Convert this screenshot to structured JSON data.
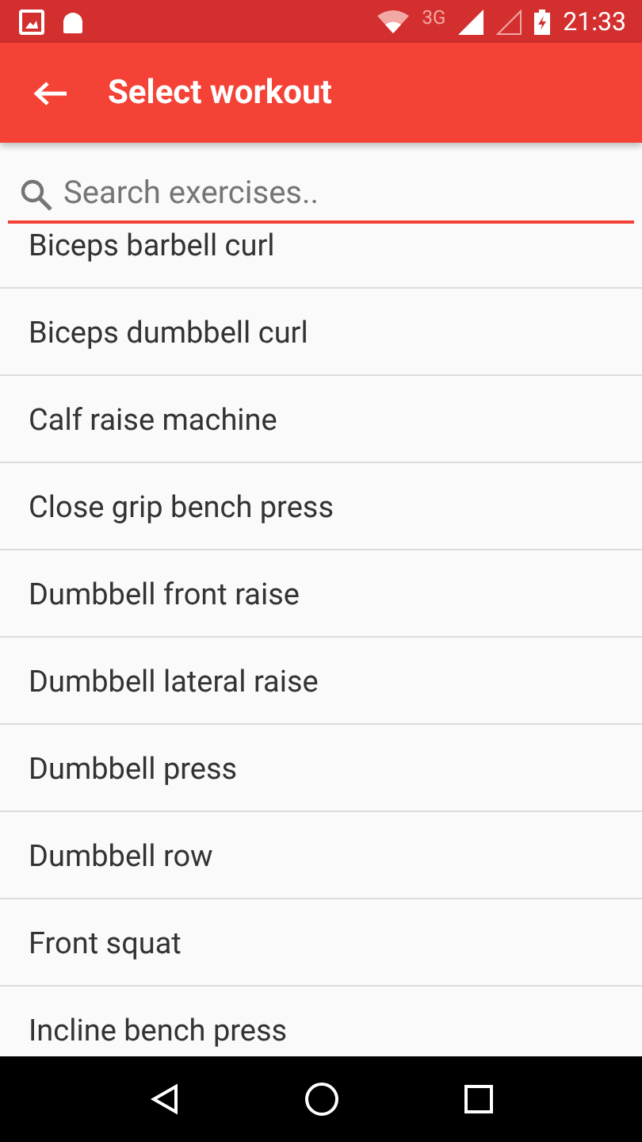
{
  "status_bar": {
    "network": "3G",
    "time": "21:33"
  },
  "app_bar": {
    "title": "Select workout"
  },
  "search": {
    "placeholder": "Search exercises.."
  },
  "exercises": [
    "Biceps barbell curl",
    "Biceps dumbbell curl",
    "Calf raise machine",
    "Close grip bench press",
    "Dumbbell front raise",
    "Dumbbell lateral raise",
    "Dumbbell press",
    "Dumbbell row",
    "Front squat",
    "Incline bench press"
  ]
}
